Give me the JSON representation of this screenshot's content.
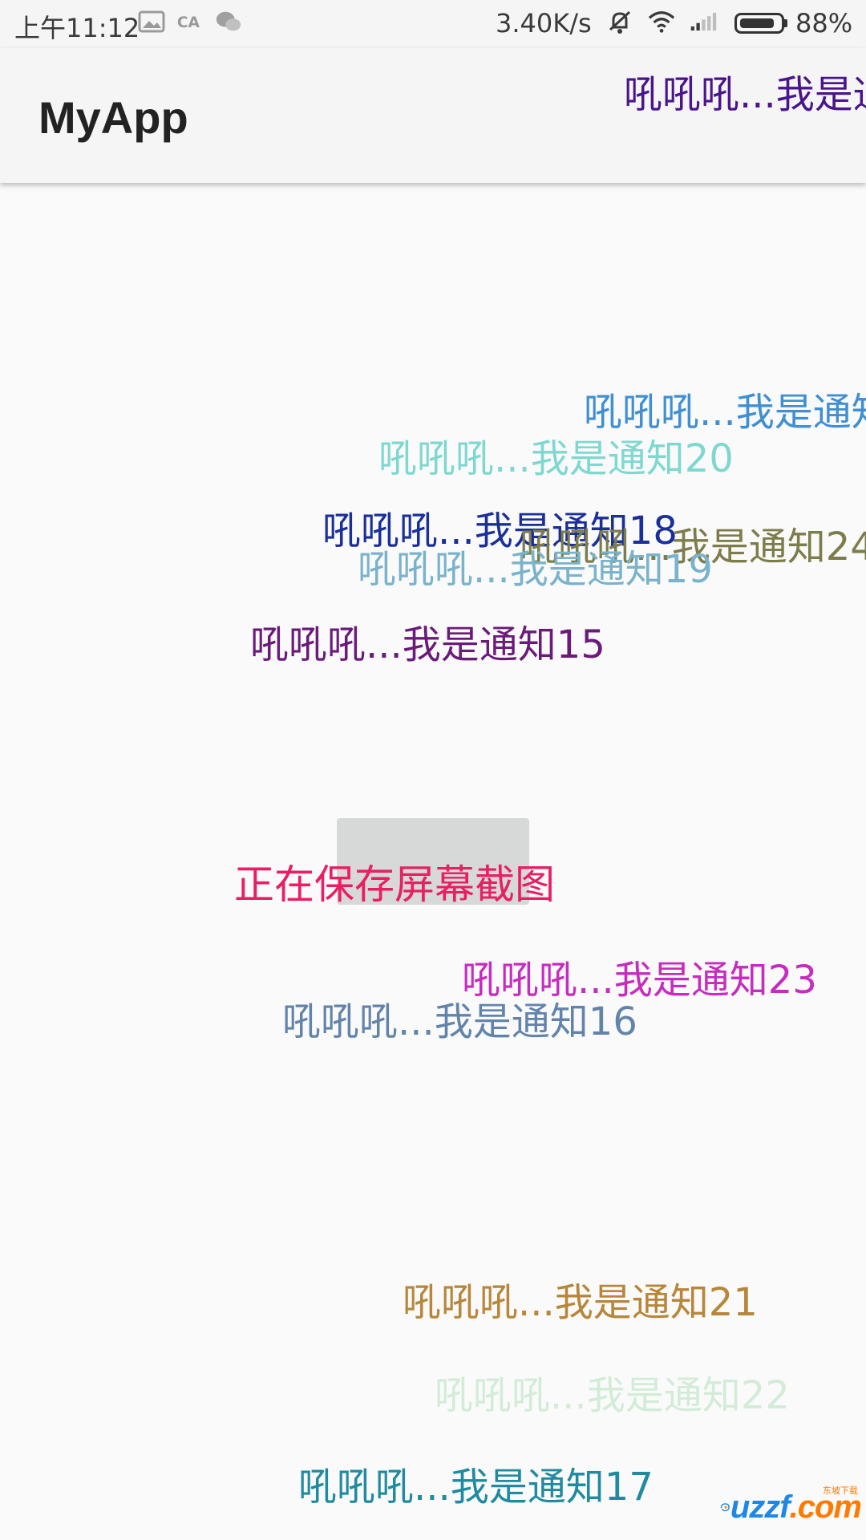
{
  "status_bar": {
    "time": "上午11:12",
    "network_speed": "3.40K/s",
    "battery_percent": "88%",
    "battery_level": 0.88,
    "icons": [
      "gallery-icon",
      "ca-icon",
      "wechat-icon",
      "mute-icon",
      "wifi-icon",
      "signal-icon",
      "battery-icon"
    ]
  },
  "app_bar": {
    "title": "MyApp"
  },
  "notifications": [
    {
      "text": "吼吼吼...我是通",
      "color": "#4a148c"
    },
    {
      "text": "吼吼吼...我是通知",
      "color": "#3f8fd2"
    },
    {
      "text": "吼吼吼...我是通知20",
      "color": "#7fd8d0"
    },
    {
      "text": "吼吼吼...我是通知18",
      "color": "#1a2f9a"
    },
    {
      "text": "吼吼吼...我是通知24",
      "color": "#7c7d4a"
    },
    {
      "text": "吼吼吼...我是通知19",
      "color": "#7ab3cc"
    },
    {
      "text": "吼吼吼...我是通知15",
      "color": "#6a1b7a"
    },
    {
      "text": "吼吼吼...我是通知23",
      "color": "#c62cc0"
    },
    {
      "text": "吼吼吼...我是通知16",
      "color": "#6284ab"
    },
    {
      "text": "吼吼吼...我是通知21",
      "color": "#b8863a"
    },
    {
      "text": "吼吼吼...我是通知22",
      "color": "#d2ecd8"
    },
    {
      "text": "吼吼吼...我是通知17",
      "color": "#1f8aa0"
    }
  ],
  "toast": {
    "text": "正在保存屏幕截图",
    "color": "#e91e63"
  },
  "watermark": {
    "text_main": "uzzf",
    "text_suffix": ".com",
    "text_cn": "东坡下载"
  }
}
